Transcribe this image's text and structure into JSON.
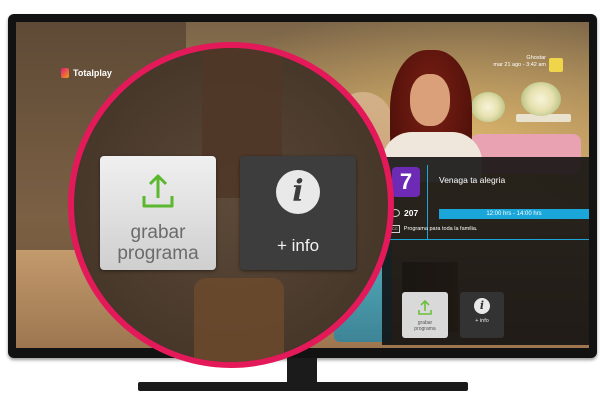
{
  "brand": {
    "logo_text": "Totalplay",
    "accent_color": "#e3195a"
  },
  "clock": {
    "line1": "Ghostar",
    "line2": "mar 21 ago - 3:42 am"
  },
  "channel": {
    "number": "207",
    "program_title": "Venaga ta alegria",
    "time_range": "12:00 hrs - 14:00 hrs",
    "description": "Programa para toda la familia.",
    "cc_label": "CC",
    "logo_label": "7"
  },
  "actions": {
    "record_label_line1": "grabar",
    "record_label_line2": "programa",
    "info_label": "+ info",
    "info_symbol": "i",
    "small_record_line1": "grabar",
    "small_record_line2": "programa",
    "small_info_label": "+ info"
  },
  "icons": [
    "upload-icon",
    "info-icon",
    "eye-icon",
    "cc-icon"
  ],
  "colors": {
    "highlight_ring": "#e3195a",
    "time_bar": "#1aa6d8",
    "channel_logo_bg": "#6d2bb5"
  }
}
